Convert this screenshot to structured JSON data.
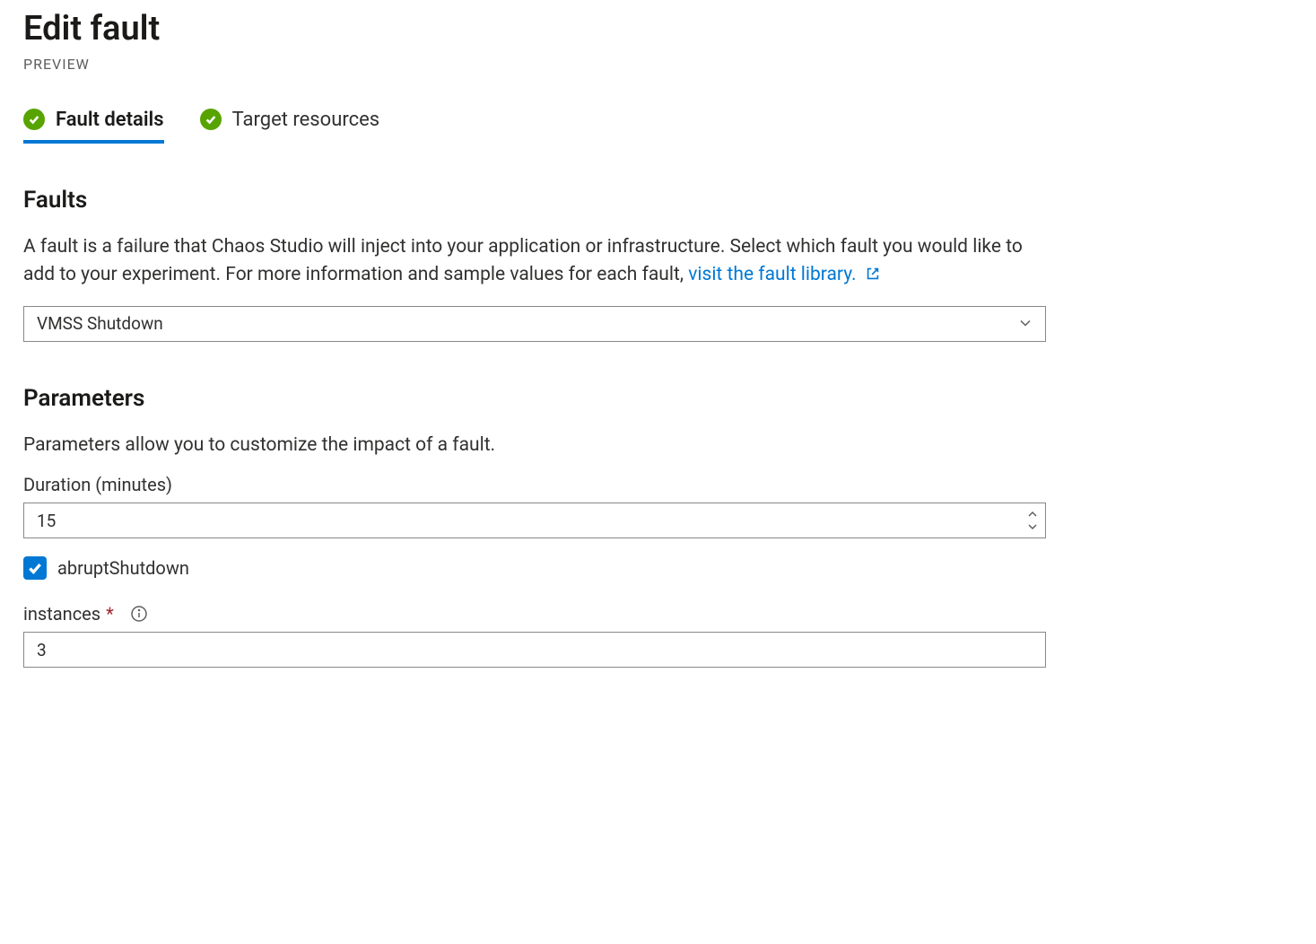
{
  "header": {
    "title": "Edit fault",
    "subtitle": "PREVIEW"
  },
  "tabs": [
    {
      "label": "Fault details",
      "active": true
    },
    {
      "label": "Target resources",
      "active": false
    }
  ],
  "faults": {
    "heading": "Faults",
    "description_prefix": "A fault is a failure that Chaos Studio will inject into your application or infrastructure. Select which fault you would like to add to your experiment. For more information and sample values for each fault, ",
    "link_text": "visit the fault library.",
    "selected": "VMSS Shutdown"
  },
  "parameters": {
    "heading": "Parameters",
    "description": "Parameters allow you to customize the impact of a fault.",
    "duration_label": "Duration (minutes)",
    "duration_value": "15",
    "abrupt_checked": true,
    "abrupt_label": "abruptShutdown",
    "instances_label": "instances",
    "instances_value": "3"
  }
}
